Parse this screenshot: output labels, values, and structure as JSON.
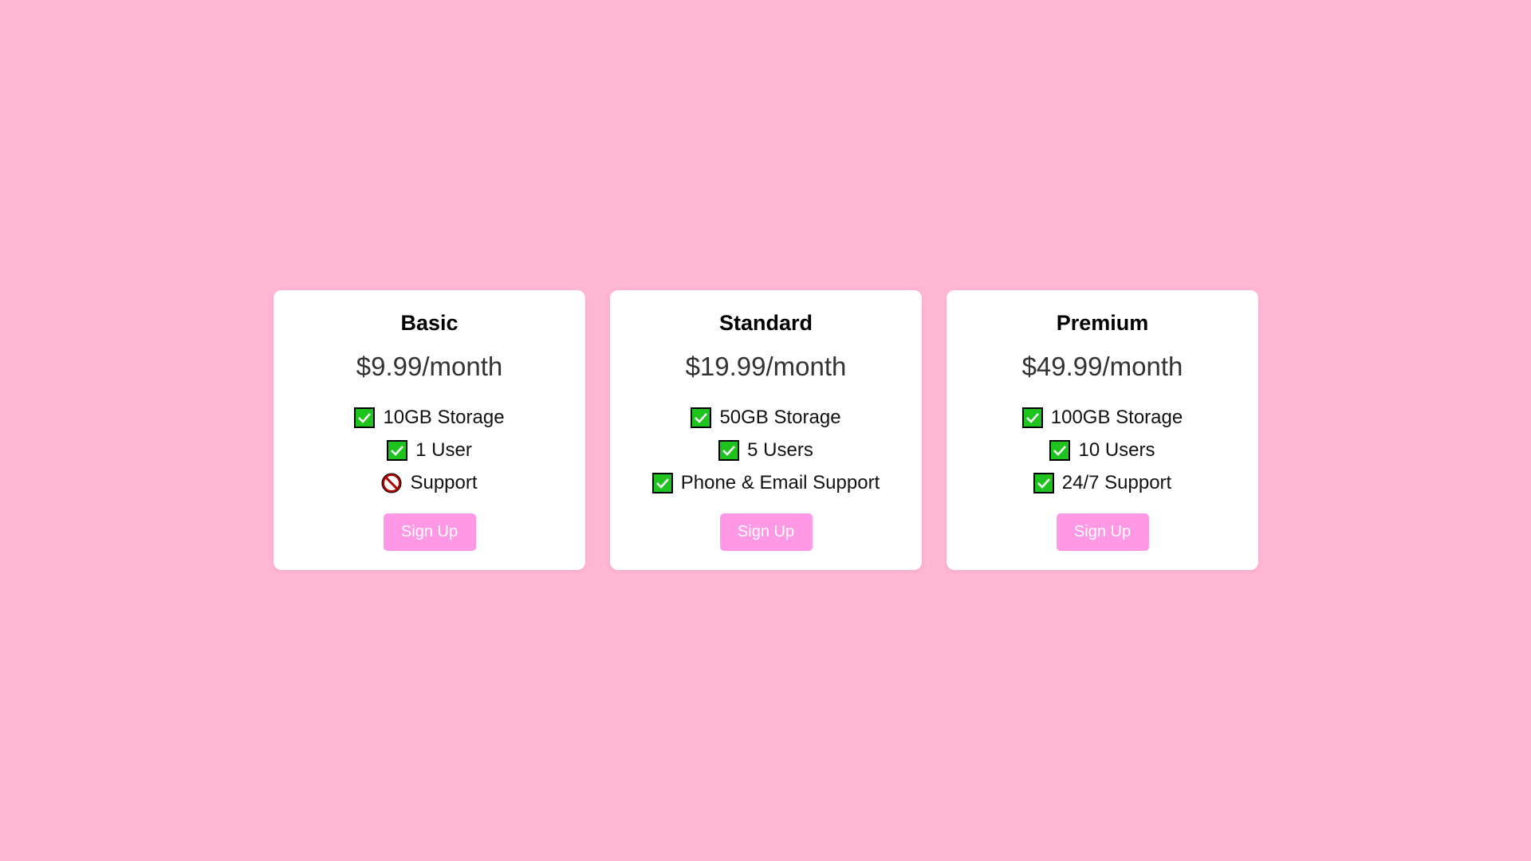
{
  "colors": {
    "background": "#ffb6d3",
    "card": "#ffffff",
    "button": "#ff99e6",
    "check": "#1ec31e"
  },
  "plans": [
    {
      "name": "Basic",
      "price": "$9.99/month",
      "features": [
        {
          "icon": "check-icon",
          "label": "10GB Storage"
        },
        {
          "icon": "check-icon",
          "label": "1 User"
        },
        {
          "icon": "prohibited-icon",
          "label": "Support"
        }
      ],
      "button": "Sign Up"
    },
    {
      "name": "Standard",
      "price": "$19.99/month",
      "features": [
        {
          "icon": "check-icon",
          "label": "50GB Storage"
        },
        {
          "icon": "check-icon",
          "label": "5 Users"
        },
        {
          "icon": "check-icon",
          "label": "Phone & Email Support"
        }
      ],
      "button": "Sign Up"
    },
    {
      "name": "Premium",
      "price": "$49.99/month",
      "features": [
        {
          "icon": "check-icon",
          "label": "100GB Storage"
        },
        {
          "icon": "check-icon",
          "label": "10 Users"
        },
        {
          "icon": "check-icon",
          "label": "24/7 Support"
        }
      ],
      "button": "Sign Up"
    }
  ]
}
